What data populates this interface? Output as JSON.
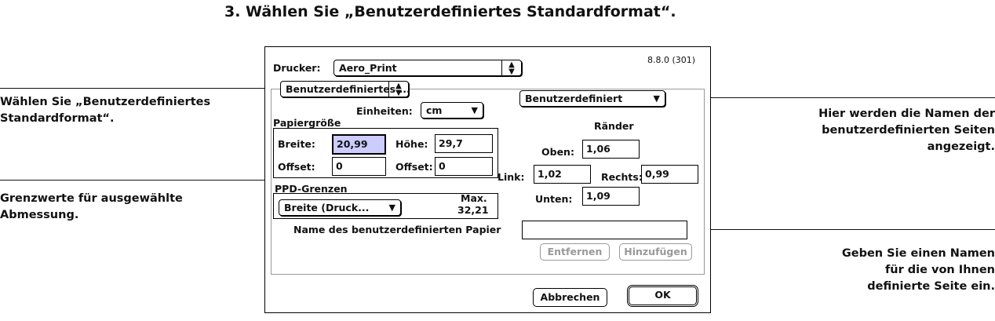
{
  "step": {
    "text": "3.  Wählen Sie „Benutzerdefiniertes Standardformat“."
  },
  "callouts": {
    "left1": [
      "Wählen Sie „Benutzerdefiniertes",
      "Standardformat“."
    ],
    "left2": [
      "Grenzwerte für ausgewählte",
      "Abmessung."
    ],
    "right1": [
      "Hier werden die Namen der",
      "benutzerdefinierten Seiten",
      "angezeigt."
    ],
    "right2": [
      "Geben Sie einen Namen",
      "für die von Ihnen",
      "definierte Seite ein."
    ]
  },
  "dialog": {
    "version": "8.8.0 (301)",
    "printer_label": "Drucker:",
    "printer_value": "Aero_Print",
    "format_value": "Benutzerdefiniertes ...",
    "custom_popup": "Benutzerdefiniert",
    "units_label": "Einheiten:",
    "units_value": "cm",
    "paper_size_label": "Papiergröße",
    "width_label": "Breite:",
    "width_value": "20,99",
    "height_label": "Höhe:",
    "height_value": "29,7",
    "offset_label": "Offset:",
    "offset_x": "0",
    "offset_label2": "Offset:",
    "offset_y": "0",
    "margins_label": "Ränder",
    "top_label": "Oben:",
    "top_value": "1,06",
    "left_label": "Link:",
    "left_value": "1,02",
    "right_label": "Rechts:",
    "right_value": "0,99",
    "bottom_label": "Unten:",
    "bottom_value": "1,09",
    "ppd_label": "PPD-Grenzen",
    "ppd_popup": "Breite (Druck...",
    "max_label": "Max.",
    "max_value": "32,21",
    "name_label": "Name des benutzerdefinierten Papier",
    "name_value": "",
    "remove_label": "Entfernen",
    "add_label": "Hinzufügen",
    "cancel_label": "Abbrechen",
    "ok_label": "OK"
  },
  "icons": {
    "updown": "up-down-arrows-icon",
    "dropdown": "triangle-down-icon"
  }
}
